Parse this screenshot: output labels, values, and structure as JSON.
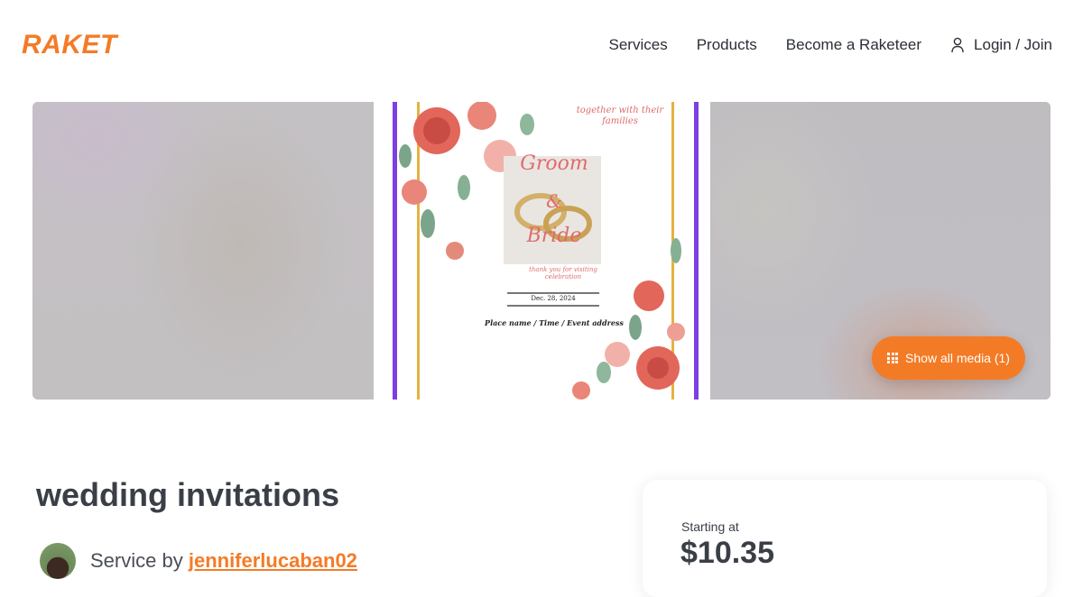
{
  "header": {
    "logo": "RAKET",
    "nav": {
      "services": "Services",
      "products": "Products",
      "become": "Become a Raketeer",
      "login": "Login / Join"
    }
  },
  "gallery": {
    "show_media_label": "Show all media (1)",
    "invitation": {
      "top_line": "together with their families",
      "groom": "Groom",
      "amp": "&",
      "bride": "Bride",
      "subline": "thank you for visiting celebration",
      "date": "Dec. 28, 2024",
      "details": "Place name / Time / Event address"
    }
  },
  "listing": {
    "title": "wedding invitations",
    "service_by_prefix": "Service by",
    "seller": "jenniferlucaban02"
  },
  "pricing": {
    "label": "Starting at",
    "price": "$10.35"
  },
  "colors": {
    "brand": "#f47b26",
    "text": "#2b2f36",
    "invite_frame": "#7b3fe4",
    "invite_gold": "#e3b341"
  },
  "icons": [
    "user-icon",
    "grid-icon",
    "avatar"
  ]
}
